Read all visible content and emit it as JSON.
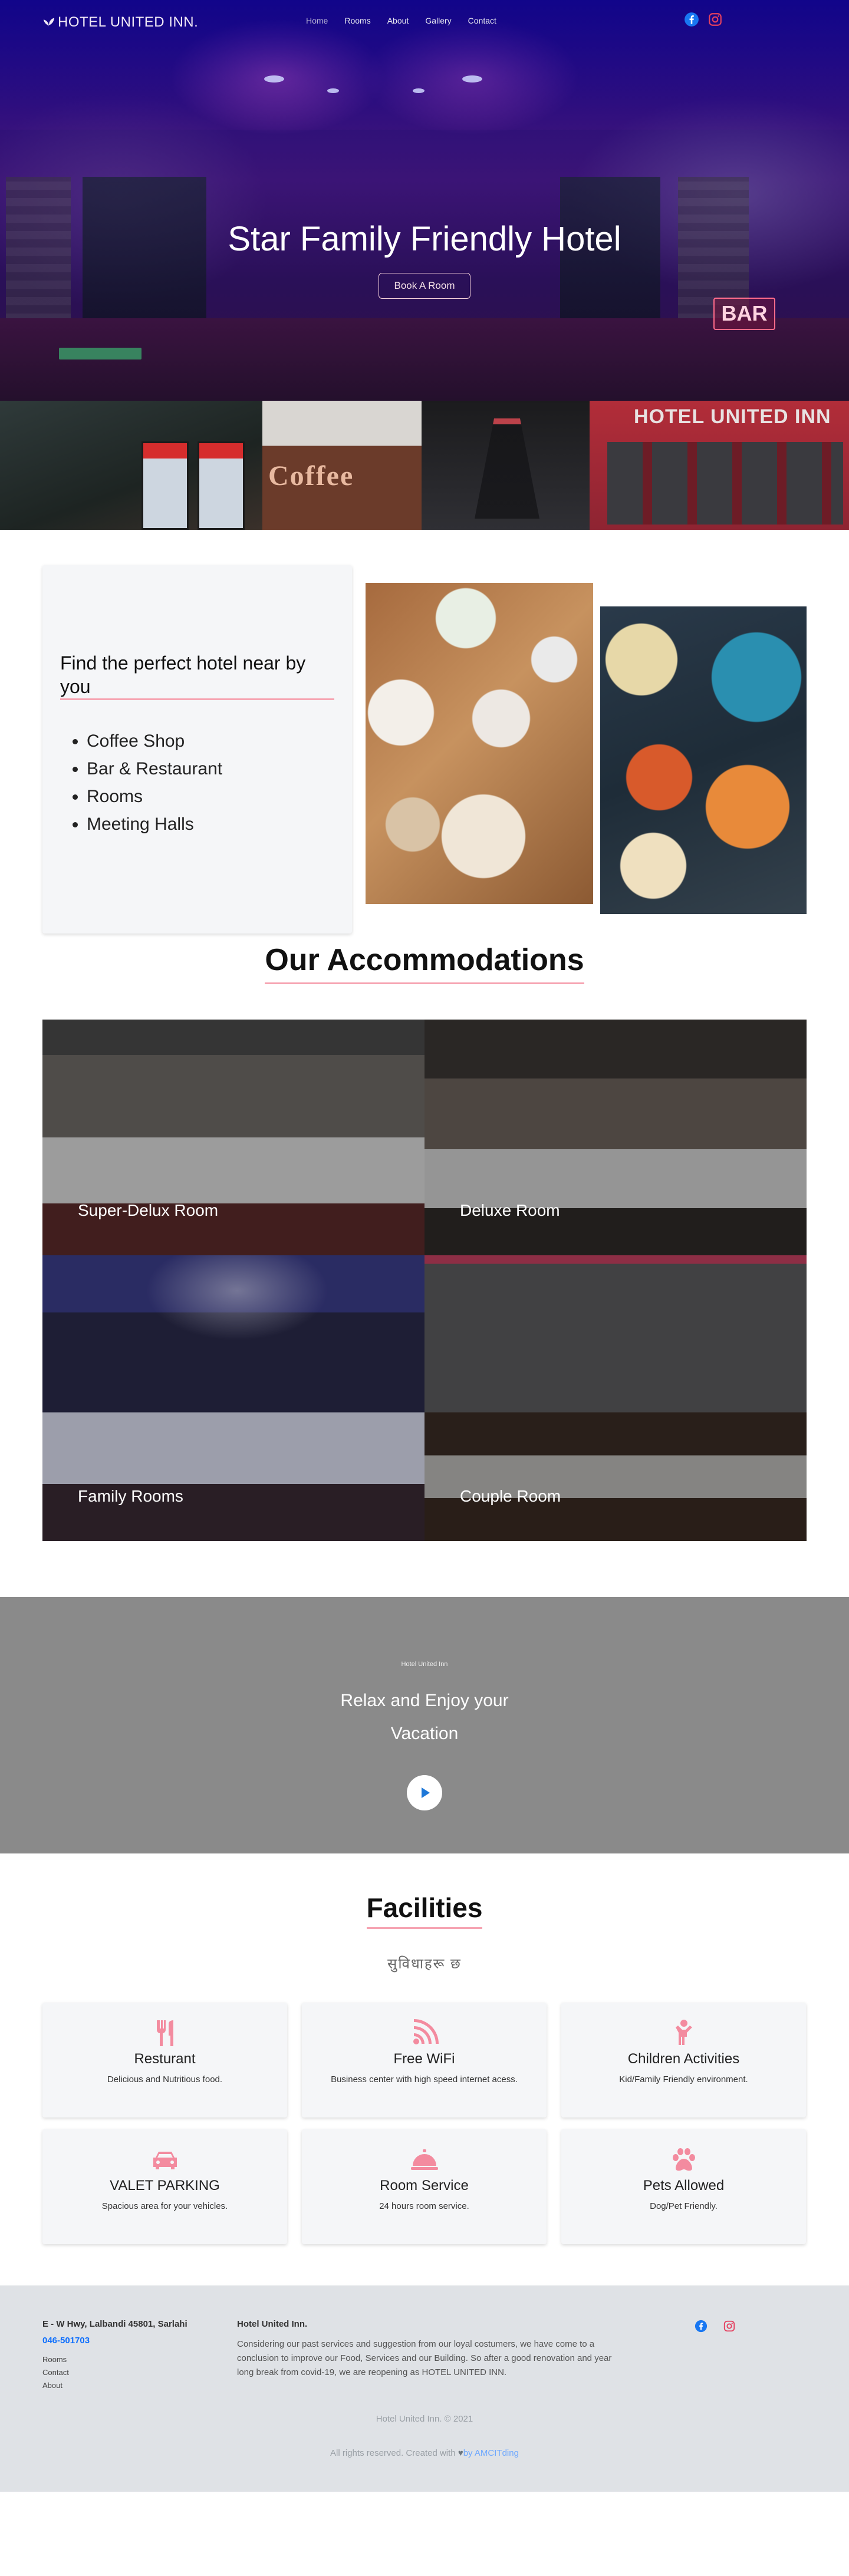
{
  "colors": {
    "accent_pink": "#f6a4b2",
    "icon_pink": "#f38b9f",
    "link_blue": "#0d6efd",
    "banner_gray": "#8a8a8a",
    "footer_bg": "#dfe2e6"
  },
  "navbar": {
    "brand": "HOTEL UNITED INN.",
    "brand_icon": "leaf-icon",
    "links": [
      "Home",
      "Rooms",
      "About",
      "Gallery",
      "Contact"
    ],
    "social_icons": [
      "facebook-icon",
      "instagram-icon"
    ]
  },
  "hero": {
    "title": "Star Family Friendly Hotel",
    "button": "Book A Room",
    "bar_sign": "BAR"
  },
  "strip": {
    "coffee_sign": "Coffee",
    "hotel_sign": "HOTEL UNITED INN"
  },
  "find": {
    "title": "Find the perfect hotel near by you",
    "items": [
      "Coffee Shop",
      "Bar & Restaurant",
      "Rooms",
      "Meeting Halls"
    ]
  },
  "accommodations": {
    "title": "Our Accommodations",
    "rooms": [
      "Super-Delux Room",
      "Deluxe Room",
      "Family Rooms",
      "Couple Room"
    ]
  },
  "relax": {
    "small": "Hotel United Inn",
    "line1": "Relax and Enjoy your",
    "line2": "Vacation"
  },
  "facilities": {
    "title": "Facilities",
    "subtitle": "सुविधाहरू छ",
    "items": [
      {
        "icon": "utensils-icon",
        "title": "Resturant",
        "desc": "Delicious and Nutritious food."
      },
      {
        "icon": "wifi-icon",
        "title": "Free WiFi",
        "desc": "Business center with high speed internet acess."
      },
      {
        "icon": "child-icon",
        "title": "Children Activities",
        "desc": "Kid/Family Friendly environment."
      },
      {
        "icon": "car-icon",
        "title": "VALET PARKING",
        "desc": "Spacious area for your vehicles."
      },
      {
        "icon": "bell-icon",
        "title": "Room Service",
        "desc": "24 hours room service."
      },
      {
        "icon": "paw-icon",
        "title": "Pets Allowed",
        "desc": "Dog/Pet Friendly."
      }
    ]
  },
  "footer": {
    "address": "E - W Hwy, Lalbandi 45801, Sarlahi",
    "phone": "046-501703",
    "links": [
      "Rooms",
      "Contact",
      "About"
    ],
    "name": "Hotel United Inn.",
    "description": "Considering our past services and suggestion from our loyal costumers, we have come to a conclusion to improve our Food, Services and our Building. So after a good renovation and year long break from covid-19, we are reopening as HOTEL UNITED INN.",
    "social_icons": [
      "facebook-icon",
      "instagram-icon"
    ],
    "copyright": "Hotel United Inn. © 2021",
    "rights_prefix": "All rights reserved. Created with",
    "rights_by": "by AMCITding"
  }
}
